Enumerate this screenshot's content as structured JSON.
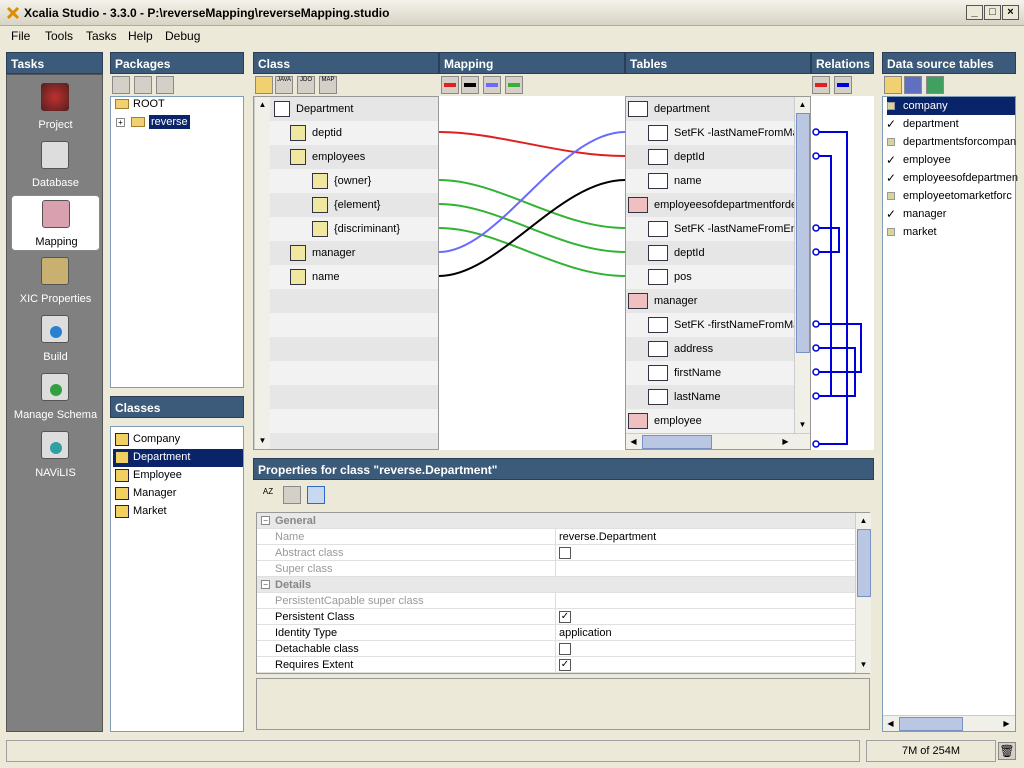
{
  "window": {
    "title": "Xcalia Studio - 3.3.0 - P:\\reverseMapping\\reverseMapping.studio"
  },
  "menu": [
    "File",
    "Tools",
    "Tasks",
    "Help",
    "Debug"
  ],
  "tasks": {
    "header": "Tasks",
    "items": [
      "Project",
      "Database",
      "Mapping",
      "XIC Properties",
      "Build",
      "Manage Schema",
      "NAViLIS"
    ],
    "selected": "Mapping"
  },
  "packages": {
    "header": "Packages",
    "root": "ROOT",
    "child": "reverse"
  },
  "classes": {
    "header": "Classes",
    "items": [
      "Company",
      "Department",
      "Employee",
      "Manager",
      "Market"
    ],
    "selected": "Department"
  },
  "mapping_panel": {
    "headers": {
      "class": "Class",
      "mapping": "Mapping",
      "tables": "Tables",
      "relations": "Relations"
    },
    "toolbar_labels": [
      "JAVA",
      "JDO",
      "MAP"
    ],
    "class_tree": {
      "root": "Department",
      "nodes": [
        {
          "label": "deptid",
          "indent": 1
        },
        {
          "label": "employees",
          "indent": 1
        },
        {
          "label": "{owner}",
          "indent": 2
        },
        {
          "label": "{element}",
          "indent": 2
        },
        {
          "label": "{discriminant}",
          "indent": 2
        },
        {
          "label": "manager",
          "indent": 1
        },
        {
          "label": "name",
          "indent": 1
        }
      ]
    },
    "tables_tree": [
      {
        "label": "department",
        "type": "table"
      },
      {
        "label": "SetFK -lastNameFromMan",
        "type": "fk"
      },
      {
        "label": "deptId",
        "type": "col"
      },
      {
        "label": "name",
        "type": "col"
      },
      {
        "label": "employeesofdepartmentforde",
        "type": "table"
      },
      {
        "label": "SetFK -lastNameFromEmp",
        "type": "fk"
      },
      {
        "label": "deptId",
        "type": "col"
      },
      {
        "label": "pos",
        "type": "col"
      },
      {
        "label": "manager",
        "type": "table"
      },
      {
        "label": "SetFK -firstNameFromMan",
        "type": "fk"
      },
      {
        "label": "address",
        "type": "col"
      },
      {
        "label": "firstName",
        "type": "col"
      },
      {
        "label": "lastName",
        "type": "col"
      },
      {
        "label": "employee",
        "type": "table"
      }
    ],
    "colors": {
      "red": "#e02020",
      "black": "#000000",
      "blue": "#6a6aff",
      "green": "#33b233",
      "relation": "#0000dd"
    }
  },
  "datasource": {
    "header": "Data source tables",
    "items": [
      {
        "label": "company",
        "checked": false,
        "selected": true
      },
      {
        "label": "department",
        "checked": true
      },
      {
        "label": "departmentsforcompan",
        "checked": false
      },
      {
        "label": "employee",
        "checked": true
      },
      {
        "label": "employeesofdepartmen",
        "checked": true
      },
      {
        "label": "employeetomarketforc",
        "checked": false
      },
      {
        "label": "manager",
        "checked": true
      },
      {
        "label": "market",
        "checked": false
      }
    ]
  },
  "properties": {
    "header": "Properties for class \"reverse.Department\"",
    "sections": [
      {
        "title": "General",
        "rows": [
          {
            "key": "Name",
            "value": "reverse.Department",
            "kind": "text",
            "disabled": true
          },
          {
            "key": "Abstract class",
            "kind": "check",
            "checked": false,
            "disabled": true
          },
          {
            "key": "Super class",
            "value": "",
            "kind": "text",
            "disabled": true
          }
        ]
      },
      {
        "title": "Details",
        "rows": [
          {
            "key": "PersistentCapable super class",
            "value": "",
            "kind": "text",
            "disabled": true
          },
          {
            "key": "Persistent Class",
            "kind": "check",
            "checked": true
          },
          {
            "key": "Identity Type",
            "value": "application",
            "kind": "text"
          },
          {
            "key": "Detachable class",
            "kind": "check",
            "checked": false
          },
          {
            "key": "Requires Extent",
            "kind": "check",
            "checked": true
          }
        ]
      }
    ]
  },
  "status": {
    "memory": "7M of 254M"
  }
}
